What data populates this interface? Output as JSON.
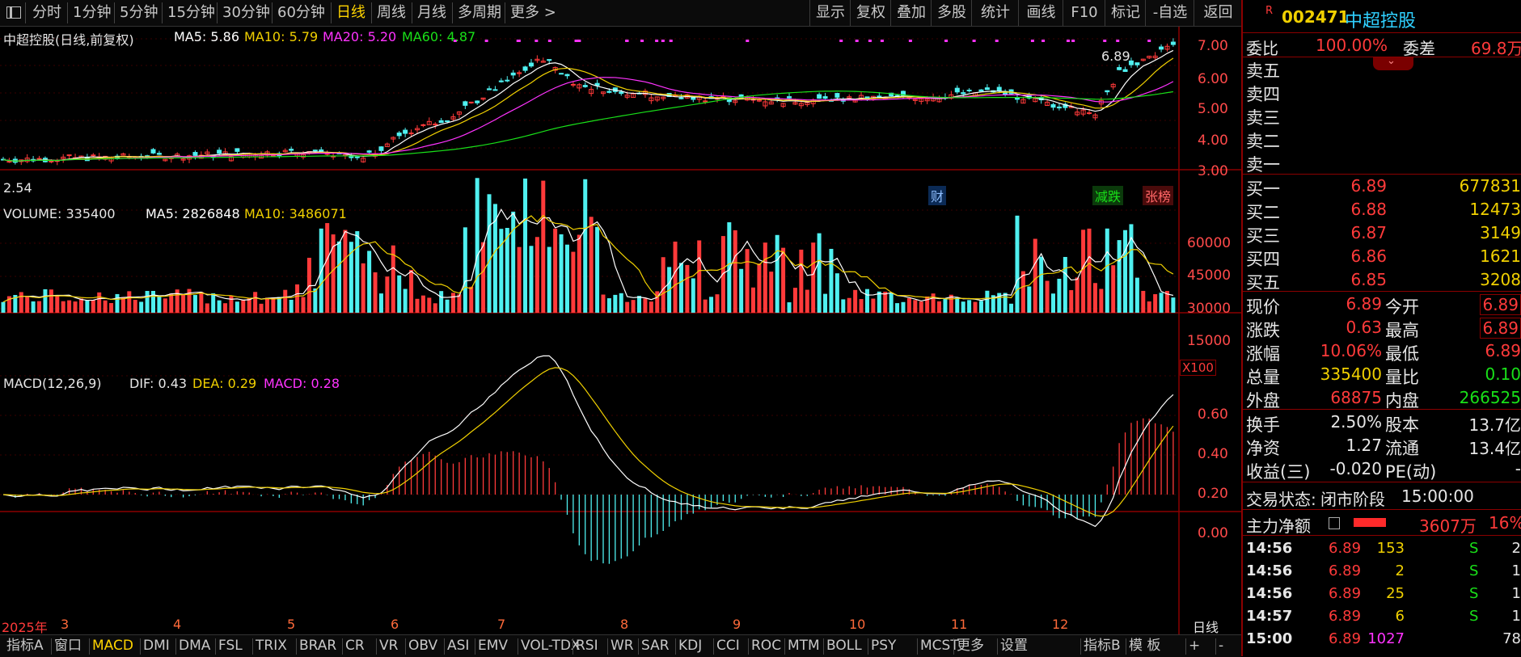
{
  "periods": [
    "分时",
    "1分钟",
    "5分钟",
    "15分钟",
    "30分钟",
    "60分钟",
    "日线",
    "周线",
    "月线",
    "多周期",
    "更多 >"
  ],
  "active_period": "日线",
  "toolbar_right": [
    "显示",
    "复权",
    "叠加",
    "多股",
    "统计",
    "画线",
    "F10",
    "标记",
    "-自选",
    "返回"
  ],
  "price_panel": {
    "title": "中超控股(日线,前复权)",
    "ma": [
      {
        "label": "MA5: 5.86",
        "color": "#ffffff"
      },
      {
        "label": "MA10: 5.79",
        "color": "#f0d000"
      },
      {
        "label": "MA20: 5.20",
        "color": "#ff33ff"
      },
      {
        "label": "MA60: 4.87",
        "color": "#19e019"
      }
    ],
    "y_ticks": [
      "7.00",
      "6.00",
      "5.00",
      "4.00",
      "3.00"
    ],
    "y_values": [
      7,
      6,
      5,
      4,
      3
    ],
    "high_label": "6.89",
    "low_label": "2.54",
    "tags": [
      {
        "text": "财",
        "color": "#5599ff"
      },
      {
        "text": "减跌",
        "color": "#19e019"
      },
      {
        "text": "张榜",
        "color": "#ff5555"
      }
    ]
  },
  "volume_panel": {
    "title": "VOLUME: 335400",
    "ma": [
      {
        "label": "MA5: 2826848",
        "color": "#ffffff"
      },
      {
        "label": "MA10: 3486071",
        "color": "#f0d000"
      }
    ],
    "y_ticks": [
      "60000",
      "45000",
      "30000",
      "15000"
    ],
    "y_values": [
      60000,
      45000,
      30000,
      15000
    ],
    "unit": "X100"
  },
  "macd_panel": {
    "title": "MACD(12,26,9)",
    "dif": "DIF: 0.43",
    "dea": "DEA: 0.29",
    "macd": "MACD: 0.28",
    "y_ticks": [
      "0.60",
      "0.40",
      "0.20",
      "0.00"
    ],
    "y_values": [
      0.6,
      0.4,
      0.2,
      0.0
    ]
  },
  "x_axis": {
    "year_label": "2025年",
    "months": [
      "3",
      "4",
      "5",
      "6",
      "7",
      "8",
      "9",
      "10",
      "11",
      "12"
    ],
    "period_label": "日线"
  },
  "bottom_tabs": [
    "指标A",
    "窗口",
    "MACD",
    "DMI",
    "DMA",
    "FSL",
    "TRIX",
    "BRAR",
    "CR",
    "VR",
    "OBV",
    "ASI",
    "EMV",
    "VOL-TDX",
    "RSI",
    "WR",
    "SAR",
    "KDJ",
    "CCI",
    "ROC",
    "MTM",
    "BOLL",
    "PSY",
    "MCST",
    "更多",
    "设置",
    "指标B",
    "模 板",
    "+",
    "-"
  ],
  "active_bottom_tab": "MACD",
  "stock": {
    "code": "002471",
    "name": "中超控股",
    "flag": "R"
  },
  "quote": {
    "weibi_label": "委比",
    "weibi": "100.00%",
    "weicha_label": "委差",
    "weicha": "69.8万",
    "sell": [
      {
        "label": "卖五"
      },
      {
        "label": "卖四"
      },
      {
        "label": "卖三"
      },
      {
        "label": "卖二"
      },
      {
        "label": "卖一"
      }
    ],
    "buy": [
      {
        "label": "买一",
        "price": "6.89",
        "vol": "677831"
      },
      {
        "label": "买二",
        "price": "6.88",
        "vol": "12473"
      },
      {
        "label": "买三",
        "price": "6.87",
        "vol": "3149"
      },
      {
        "label": "买四",
        "price": "6.86",
        "vol": "1621"
      },
      {
        "label": "买五",
        "price": "6.85",
        "vol": "3208"
      }
    ],
    "stats": [
      {
        "l": "现价",
        "v": "6.89",
        "vc": "red",
        "l2": "今开",
        "v2": "6.89",
        "v2c": "red",
        "box": true
      },
      {
        "l": "涨跌",
        "v": "0.63",
        "vc": "red",
        "l2": "最高",
        "v2": "6.89",
        "v2c": "red",
        "box": true
      },
      {
        "l": "涨幅",
        "v": "10.06%",
        "vc": "red",
        "l2": "最低",
        "v2": "6.89",
        "v2c": "red",
        "box": false
      },
      {
        "l": "总量",
        "v": "335400",
        "vc": "yel",
        "l2": "量比",
        "v2": "0.10",
        "v2c": "grn",
        "box": false
      },
      {
        "l": "外盘",
        "v": "68875",
        "vc": "red",
        "l2": "内盘",
        "v2": "266525",
        "v2c": "grn",
        "box": false
      }
    ],
    "stats2": [
      {
        "l": "换手",
        "v": "2.50%",
        "l2": "股本",
        "v2": "13.7亿"
      },
      {
        "l": "净资",
        "v": "1.27",
        "l2": "流通",
        "v2": "13.4亿"
      },
      {
        "l": "收益(三)",
        "v": "-0.020",
        "l2": "PE(动)",
        "v2": "-"
      }
    ],
    "status_label": "交易状态:",
    "status": "闭市阶段",
    "status_time": "15:00:00",
    "net_label": "主力净额",
    "net_value": "3607万",
    "net_pct": "16%"
  },
  "ticks": [
    {
      "t": "14:56",
      "p": "6.89",
      "v": "153",
      "s": "S",
      "n": "2"
    },
    {
      "t": "14:56",
      "p": "6.89",
      "v": "2",
      "s": "S",
      "n": "1"
    },
    {
      "t": "14:56",
      "p": "6.89",
      "v": "25",
      "s": "S",
      "n": "1"
    },
    {
      "t": "14:57",
      "p": "6.89",
      "v": "6",
      "s": "S",
      "n": "1"
    },
    {
      "t": "15:00",
      "p": "6.89",
      "v": "1027",
      "s": "",
      "n": "78"
    }
  ]
}
